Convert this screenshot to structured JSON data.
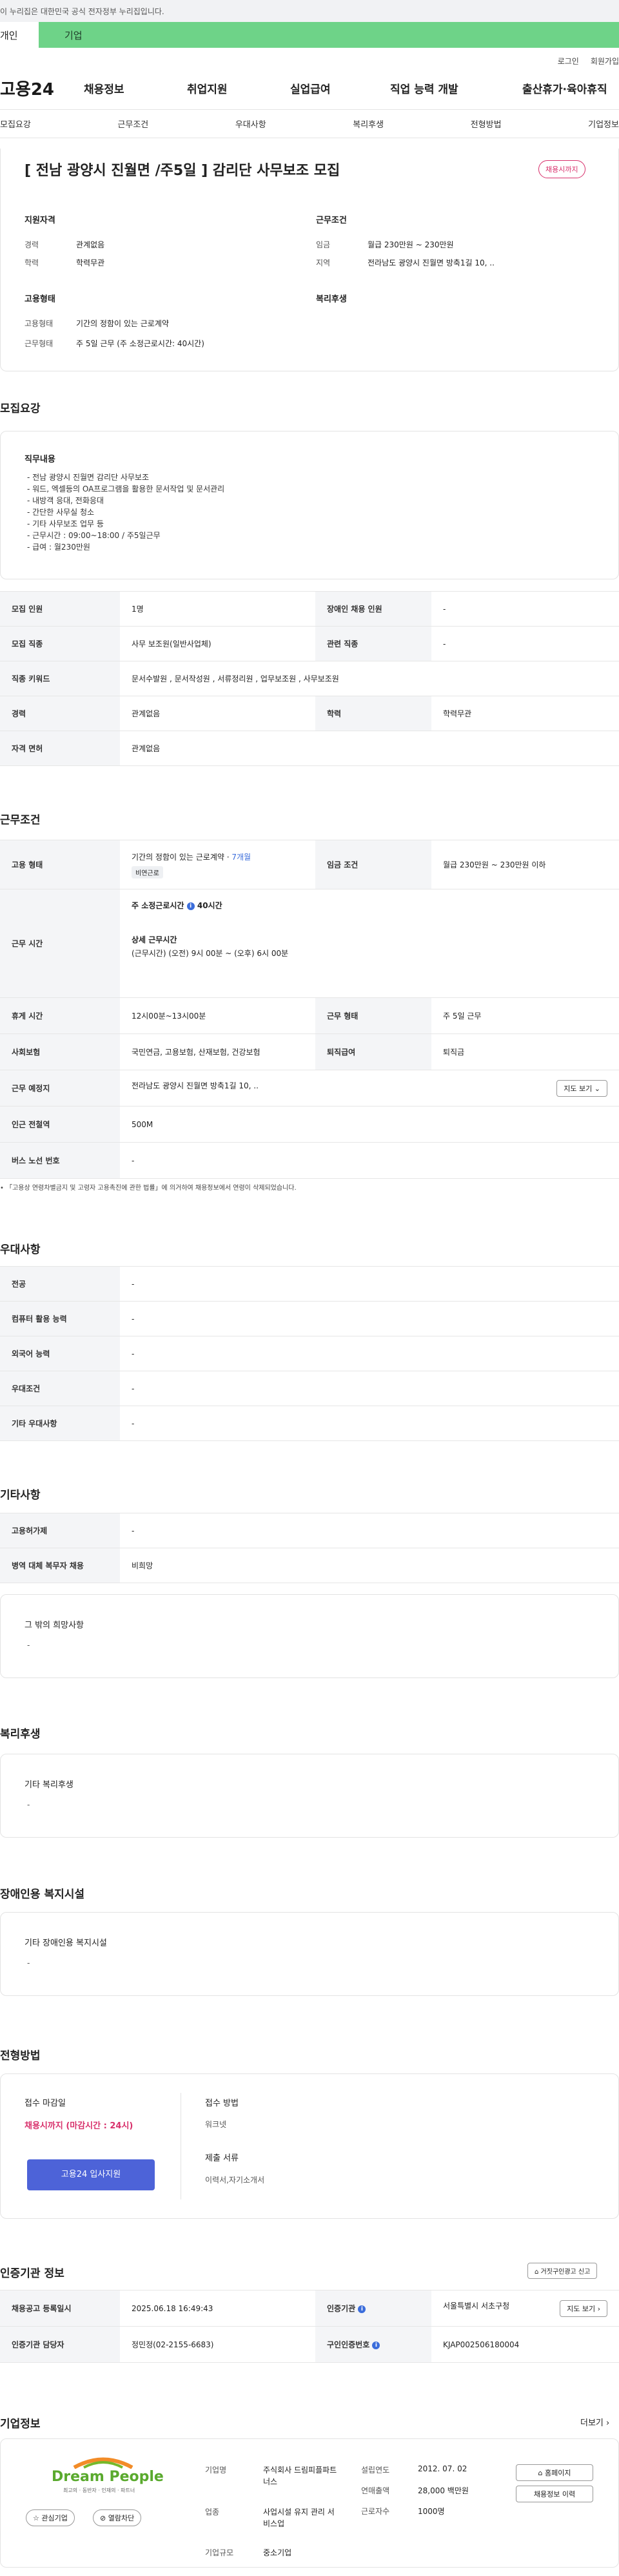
{
  "gov_banner": "이 누리집은 대한민국 공식 전자정부 누리집입니다.",
  "top_tabs": {
    "personal": "개인",
    "corp": "기업"
  },
  "util": {
    "login": "로그인",
    "join": "회원가입"
  },
  "logo": "고용24",
  "gnb": [
    "채용정보",
    "취업지원",
    "실업급여",
    "직업 능력 개발",
    "출산휴가·육아휴직"
  ],
  "anchors": [
    "모집요강",
    "근무조건",
    "우대사항",
    "복리후생",
    "전형방법",
    "기업정보"
  ],
  "summary": {
    "title": "[ 전남 광양시 진월면 /주5일 ] 감리단 사무보조 모집",
    "status_badge": "채용시까지",
    "qual_h": "지원자격",
    "career_k": "경력",
    "career_v": "관계없음",
    "edu_k": "학력",
    "edu_v": "학력무관",
    "cond_h": "근무조건",
    "wage_k": "임금",
    "wage_v": "월급 230만원 ~ 230만원",
    "region_k": "지역",
    "region_v": "전라남도 광양시 진월면 방축1길 10, ..",
    "type_h": "고용형태",
    "emp_k": "고용형태",
    "emp_v": "기간의 정함이 있는 근로계약",
    "hours_k": "근무형태",
    "hours_v": "주 5일 근무 (주 소정근로시간: 40시간)",
    "welfare_h": "복리후생"
  },
  "recruit": {
    "heading": "모집요강",
    "duty_h": "직무내용",
    "duty_lines": [
      "- 전남 광양시 진월면 감리단 사무보조",
      "- 워드, 엑셀등의 OA프로그램을 활용한 문서작업 및 문서관리",
      "- 내방객 응대, 전화응대",
      "- 간단한 사무실 청소",
      "- 기타 사무보조 업무 등",
      "- 근무시간 : 09:00~18:00 / 주5일근무",
      "- 급여 : 월230만원"
    ],
    "rows": {
      "count_k": "모집 인원",
      "count_v": "1명",
      "disab_k": "장애인 채용 인원",
      "disab_v": "-",
      "job_k": "모집 직종",
      "job_v": "사무 보조원(일반사업체)",
      "rel_k": "관련 직종",
      "rel_v": "-",
      "kw_k": "직종 키워드",
      "kw_v": "문서수발원 , 문서작성원 , 서류정리원 , 업무보조원 , 사무보조원",
      "car_k": "경력",
      "car_v": "관계없음",
      "edu_k": "학력",
      "edu_v": "학력무관",
      "lic_k": "자격 면허",
      "lic_v": "관계없음"
    }
  },
  "work": {
    "heading": "근무조건",
    "emp_k": "고용 형태",
    "emp_v": "기간의 정함이 있는 근로계약 · ",
    "emp_period": "7개월",
    "emp_sub": "비연근로",
    "wage_k": "임금 조건",
    "wage_v": "월급 230만원 ~ 230만원 이하",
    "time_k": "근무 시간",
    "time_main": "주 소정근로시간",
    "time_hours": "40시간",
    "time_detail_h": "상세 근무시간",
    "time_detail": "(근무시간) (오전) 9시 00분 ~ (오후) 6시 00분",
    "rest_k": "휴게 시간",
    "rest_v": "12시00분~13시00분",
    "form_k": "근무 형태",
    "form_v": "주 5일 근무",
    "ins_k": "사회보험",
    "ins_v": "국민연금, 고용보험, 산재보험, 건강보험",
    "ret_k": "퇴직급여",
    "ret_v": "퇴직금",
    "place_k": "근무 예정지",
    "place_v": "전라남도 광양시 진월면 방축1길 10, ..",
    "map_btn": "지도 보기",
    "stn_k": "인근 전철역",
    "stn_v": "500M",
    "bus_k": "버스 노선 번호",
    "bus_v": "-",
    "note": "「고용상 연령차별금지 및 고령자 고용촉진에 관한 법률」에 의거하여 채용정보에서 연령이 삭제되었습니다."
  },
  "pref": {
    "heading": "우대사항",
    "rows": [
      [
        "전공",
        "-"
      ],
      [
        "컴퓨터 활용 능력",
        "-"
      ],
      [
        "외국어 능력",
        "-"
      ],
      [
        "우대조건",
        "-"
      ],
      [
        "기타 우대사항",
        "-"
      ]
    ]
  },
  "etc": {
    "heading": "기타사항",
    "rows": [
      [
        "고용허가제",
        "-"
      ],
      [
        "병역 대체 복무자 채용",
        "비희망"
      ]
    ],
    "other_h": "그 밖의 희망사항",
    "other_v": "-"
  },
  "welfare": {
    "heading": "복리후생",
    "box_h": "기타 복리후생",
    "box_v": "-"
  },
  "disab": {
    "heading": "장애인용 복지시설",
    "box_h": "기타 장애인용 복지시설",
    "box_v": "-"
  },
  "selection": {
    "heading": "전형방법",
    "deadline_h": "접수 마감일",
    "deadline_v": "채용시까지 (마감시간 : 24시)",
    "apply_btn": "고용24 입사지원",
    "method_h": "접수 방법",
    "method_v": "워크넷",
    "docs_h": "제출 서류",
    "docs_v": "이력서,자기소개서"
  },
  "cert": {
    "heading": "인증기관 정보",
    "report_btn": "거짓구인광고 신고",
    "reg_k": "채용공고 등록일시",
    "reg_v": "2025.06.18 16:49:43",
    "org_k": "인증기관",
    "org_v": "서울특별시 서초구청",
    "map_btn": "지도 보기",
    "mgr_k": "인증기관 담당자",
    "mgr_v": "정민정(02-2155-6683)",
    "num_k": "구인인증번호",
    "num_v": "KJAP002506180004"
  },
  "company": {
    "heading": "기업정보",
    "more": "더보기",
    "logo_text": "Dream People",
    "logo_sub": "최고의 · 동반자 · 인재의 · 파트너",
    "fav_btn": "관심기업",
    "block_btn": "열람차단",
    "name_k": "기업명",
    "name_v": "주식회사 드림피플파트너스",
    "biz_k": "업종",
    "biz_v": "사업시설 유지 관리 서비스업",
    "size_k": "기업규모",
    "size_v": "중소기업",
    "est_k": "설립연도",
    "est_v": "2012. 07. 02",
    "sales_k": "연매출액",
    "sales_v": "28,000 백만원",
    "emp_k": "근로자수",
    "emp_v": "1000명",
    "home_btn": "홈페이지",
    "list_btn": "채용정보 이력"
  }
}
